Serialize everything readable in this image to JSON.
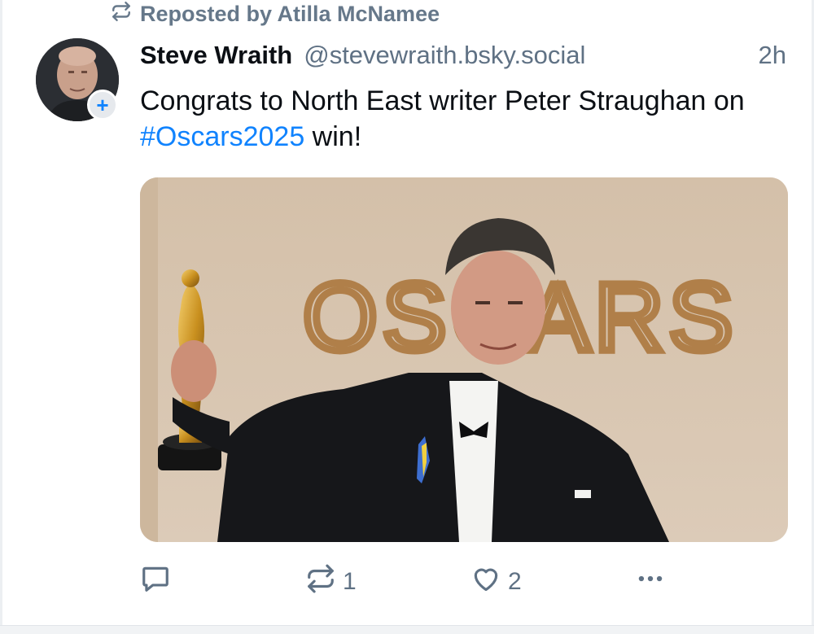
{
  "repost_banner": {
    "label": "Reposted by Atilla McNamee",
    "icon": "repost-icon"
  },
  "author": {
    "name": "Steve Wraith",
    "handle": "@stevewraith.bsky.social",
    "avatar_icon": "avatar-photo",
    "follow_label": "+"
  },
  "post": {
    "time": "2h",
    "text_before": "Congrats to North East writer Peter Straughan on ",
    "hashtag": "#Oscars2025",
    "text_after": " win!",
    "media": {
      "type": "photo",
      "sign_text": "OSCARS"
    }
  },
  "actions": {
    "reply_count": "",
    "repost_count": "1",
    "like_count": "2",
    "icons": {
      "reply": "reply-icon",
      "repost": "repost-icon",
      "like": "heart-icon",
      "more": "more-icon"
    }
  },
  "colors": {
    "accent": "#1083fe",
    "muted": "#5f7184",
    "text": "#0b0f14"
  }
}
